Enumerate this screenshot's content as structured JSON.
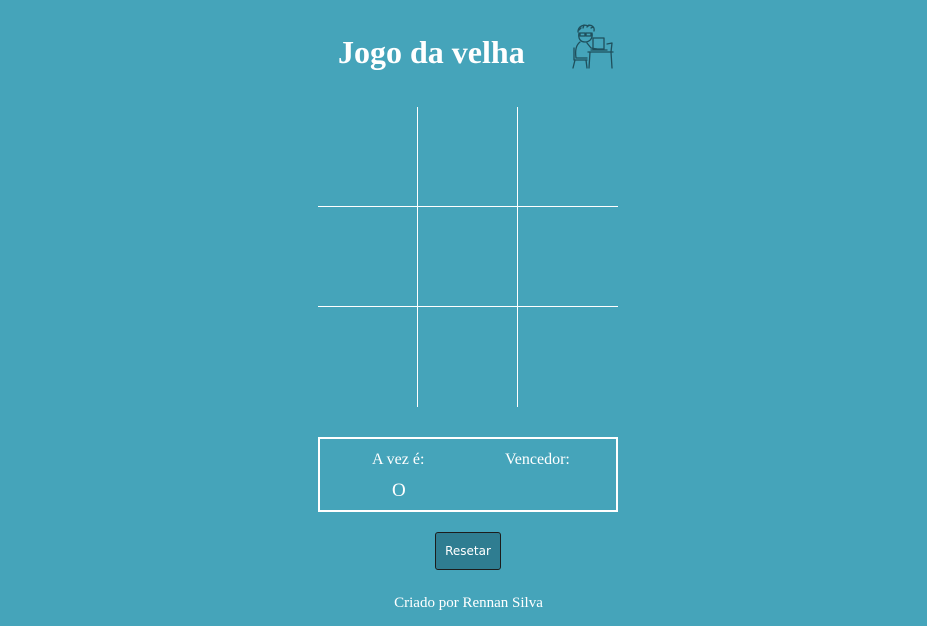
{
  "header": {
    "title": "Jogo da velha",
    "logo_icon": "person-at-computer-icon"
  },
  "board": {
    "cells": [
      "",
      "",
      "",
      "",
      "",
      "",
      "",
      "",
      ""
    ]
  },
  "status": {
    "turn_label": "A vez é:",
    "turn_value": "O",
    "winner_label": "Vencedor:",
    "winner_value": ""
  },
  "controls": {
    "reset_label": "Resetar"
  },
  "footer": {
    "credit": "Criado por Rennan Silva"
  },
  "colors": {
    "background": "#45a4ba",
    "text": "#ffffff",
    "button": "#2f7d91",
    "logo_stroke": "#1f4f5c"
  }
}
